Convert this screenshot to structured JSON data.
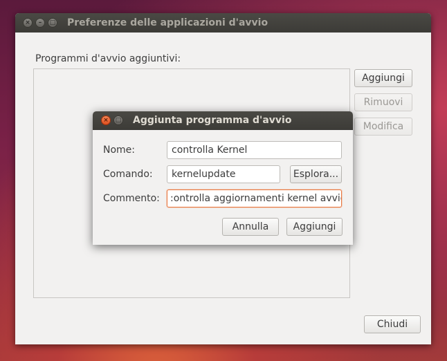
{
  "main_window": {
    "title": "Preferenze delle applicazioni d'avvio",
    "programs_label": "Programmi d'avvio aggiuntivi:",
    "add_label": "Aggiungi",
    "remove_label": "Rimuovi",
    "edit_label": "Modifica",
    "close_label": "Chiudi"
  },
  "dialog": {
    "title": "Aggiunta programma d'avvio",
    "name_label": "Nome:",
    "name_value": "controlla Kernel",
    "command_label": "Comando:",
    "command_value": "kernelupdate",
    "browse_label": "Esplora...",
    "comment_label": "Commento:",
    "comment_value": ":ontrolla aggiornamenti kernel avvio",
    "cancel_label": "Annulla",
    "add_label": "Aggiungi"
  },
  "icons": {
    "close": "close-icon",
    "minimize": "minimize-icon",
    "maximize": "maximize-icon"
  },
  "colors": {
    "titlebar": "#3c3b37",
    "window_bg": "#f2f1f0",
    "close_active": "#de4b1b",
    "focus_border": "#e9773f"
  }
}
